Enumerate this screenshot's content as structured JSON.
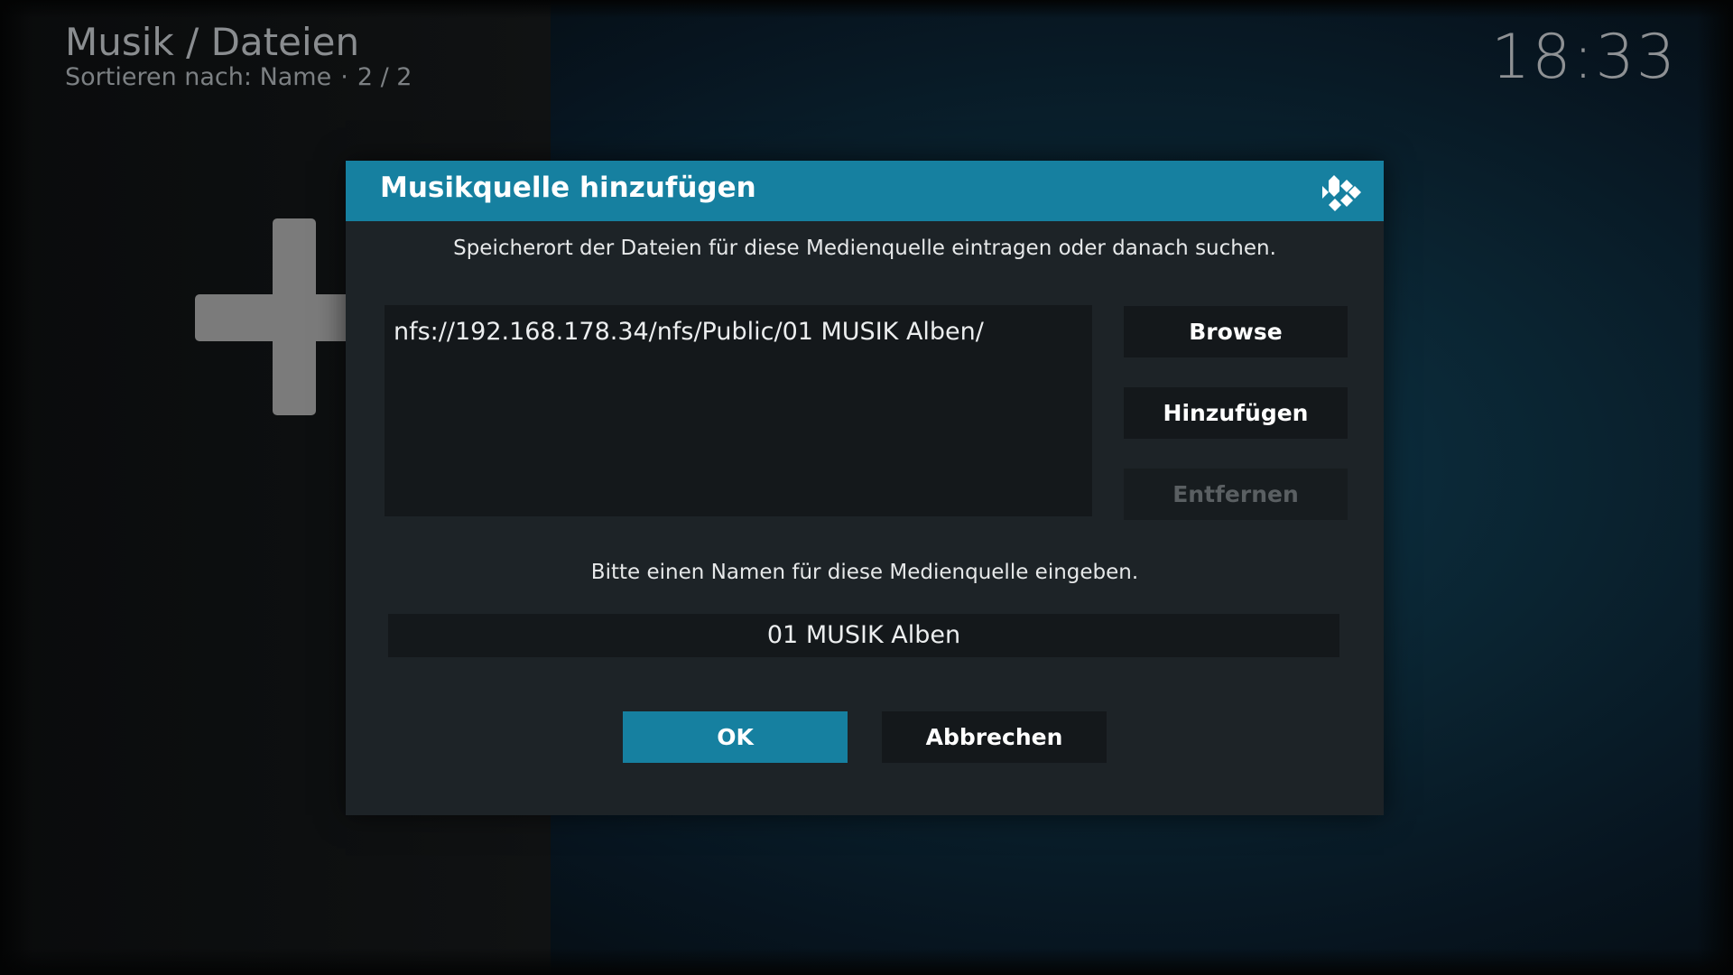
{
  "header": {
    "breadcrumb": "Musik / Dateien",
    "sort_text": "Sortieren nach: Name",
    "separator": "·",
    "page_count": "2 / 2"
  },
  "clock": "18:33",
  "dialog": {
    "title": "Musikquelle hinzufügen",
    "path_prompt": "Speicherort der Dateien für diese Medienquelle eintragen oder danach suchen.",
    "paths": [
      "nfs://192.168.178.34/nfs/Public/01 MUSIK Alben/"
    ],
    "browse_label": "Browse",
    "add_label": "Hinzufügen",
    "remove_label": "Entfernen",
    "name_prompt": "Bitte einen Namen für diese Medienquelle eingeben.",
    "name_value": "01 MUSIK Alben",
    "ok_label": "OK",
    "cancel_label": "Abbrechen"
  },
  "colors": {
    "accent": "#1680a0",
    "dialog_bg": "#1d2327",
    "control_bg": "#14181b",
    "disabled_text": "#5a5f62"
  },
  "icons": {
    "background": "plus-icon",
    "dialog_logo": "kodi-logo-icon"
  }
}
